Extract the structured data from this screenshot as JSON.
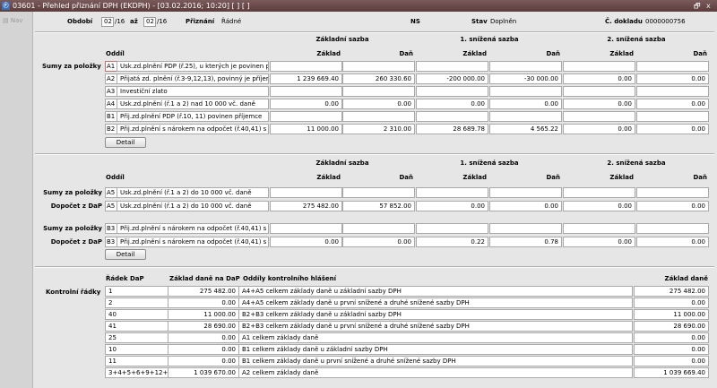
{
  "window": {
    "title": "03601 - Přehled přiznání DPH (EKDPH) - [03.02.2016; 10:20] [ ] [ ]",
    "app_icon": "app-logo-icon",
    "restore_glyph": "🗗",
    "close_glyph": "x"
  },
  "sidebar": {
    "nav_label": "Nav"
  },
  "header": {
    "period_label": "Období",
    "period_from_month": "02",
    "period_from_year": "/16",
    "to_label": "až",
    "period_to_month": "02",
    "period_to_year": "/16",
    "priznani_label": "Přiznání",
    "priznani_value": "Řádné",
    "ns_label": "NS",
    "stav_label": "Stav",
    "stav_value": "Doplněn",
    "doklad_label": "Č. dokladu",
    "doklad_value": "0000000756"
  },
  "section1": {
    "groups": [
      "Základní sazba",
      "1. snížená sazba",
      "2. snížená sazba"
    ],
    "subheaders": [
      "Základ",
      "Daň",
      "Základ",
      "Daň",
      "Základ",
      "Daň"
    ],
    "oddil_label": "Oddíl",
    "row_label": "Sumy za položky",
    "rows": [
      {
        "code": "A1",
        "desc": "Usk.zd.plnění PDP (ř.25), u kterých je povinen přij",
        "values": [
          "",
          "",
          "",
          "",
          "",
          ""
        ],
        "highlight": true
      },
      {
        "code": "A2",
        "desc": "Přijatá zd. plnění (ř.3-9,12,13), povinný je příjemce",
        "values": [
          "1 239 669.40",
          "260 330.60",
          "-200 000.00",
          "-30 000.00",
          "0.00",
          "0.00"
        ],
        "highlight": false
      },
      {
        "code": "A3",
        "desc": "Investiční zlato",
        "values": [
          "",
          "",
          "",
          "",
          "",
          ""
        ],
        "highlight": false
      },
      {
        "code": "A4",
        "desc": "Usk.zd.plnění (ř.1 a 2) nad 10 000 vč. daně",
        "values": [
          "0.00",
          "0.00",
          "0.00",
          "0.00",
          "0.00",
          "0.00"
        ],
        "highlight": false
      },
      {
        "code": "B1",
        "desc": "Přij.zd.plnění PDP (ř.10, 11) povinen příjemce",
        "values": [
          "",
          "",
          "",
          "",
          "",
          ""
        ],
        "highlight": false
      },
      {
        "code": "B2",
        "desc": "Přij.zd.plnění s nárokem na odpočet (ř.40,41) s hc",
        "values": [
          "11 000.00",
          "2 310.00",
          "28 689.78",
          "4 565.22",
          "0.00",
          "0.00"
        ],
        "highlight": false
      }
    ],
    "detail_button": "Detail"
  },
  "section2": {
    "groups": [
      "Základní sazba",
      "1. snížená sazba",
      "2. snížená sazba"
    ],
    "subheaders": [
      "Základ",
      "Daň",
      "Základ",
      "Daň",
      "Základ",
      "Daň"
    ],
    "oddil_label": "Oddíl",
    "rows": [
      {
        "label": "Sumy za položky",
        "code": "A5",
        "desc": "Usk.zd.plnění (ř.1 a 2)  do 10 000 vč. daně",
        "values": [
          "",
          "",
          "",
          "",
          "",
          ""
        ]
      },
      {
        "label": "Dopočet z DaP",
        "code": "A5",
        "desc": "Usk.zd.plnění (ř.1 a 2)  do 10 000 vč. daně",
        "values": [
          "275 482.00",
          "57 852.00",
          "0.00",
          "0.00",
          "0.00",
          "0.00"
        ]
      },
      {
        "label": "Sumy za položky",
        "code": "B3",
        "desc": "Přij.zd.plnění s nárokem na odpočet (ř.40,41) s ho",
        "values": [
          "",
          "",
          "",
          "",
          "",
          ""
        ]
      },
      {
        "label": "Dopočet z DaP",
        "code": "B3",
        "desc": "Přij.zd.plnění s nárokem na odpočet (ř.40,41) s ho",
        "values": [
          "0.00",
          "0.00",
          "0.22",
          "0.78",
          "0.00",
          "0.00"
        ]
      }
    ],
    "detail_button": "Detail"
  },
  "section3": {
    "label": "Kontrolní řádky",
    "headers": {
      "radek": "Řádek DaP",
      "zaklad": "Základ daně na DaP",
      "oddily": "Oddíly kontrolního hlášení",
      "zaklad_right": "Základ daně"
    },
    "rows": [
      {
        "radek": "1",
        "zaklad": "275 482.00",
        "oddily": "A4+A5 celkem základy daně u základní sazby DPH",
        "zaklad_right": "275 482.00"
      },
      {
        "radek": "2",
        "zaklad": "0.00",
        "oddily": "A4+A5 celkem základy daně u první snížené a druhé snížené sazby DPH",
        "zaklad_right": "0.00"
      },
      {
        "radek": "40",
        "zaklad": "11 000.00",
        "oddily": "B2+B3 celkem základy daně u základní sazby DPH",
        "zaklad_right": "11 000.00"
      },
      {
        "radek": "41",
        "zaklad": "28 690.00",
        "oddily": "B2+B3 celkem základy daně u první snížené a druhé snížené sazby DPH",
        "zaklad_right": "28 690.00"
      },
      {
        "radek": "25",
        "zaklad": "0.00",
        "oddily": "A1 celkem základy daně",
        "zaklad_right": "0.00"
      },
      {
        "radek": "10",
        "zaklad": "0.00",
        "oddily": "B1 celkem základy daně u základní sazby DPH",
        "zaklad_right": "0.00"
      },
      {
        "radek": "11",
        "zaklad": "0.00",
        "oddily": "B1 celkem základy daně u první snížené a druhé snížené sazby DPH",
        "zaklad_right": "0.00"
      },
      {
        "radek": "3+4+5+6+9+12+13",
        "zaklad": "1 039 670.00",
        "oddily": "A2 celkem základy daně",
        "zaklad_right": "1 039 669.40"
      }
    ]
  }
}
